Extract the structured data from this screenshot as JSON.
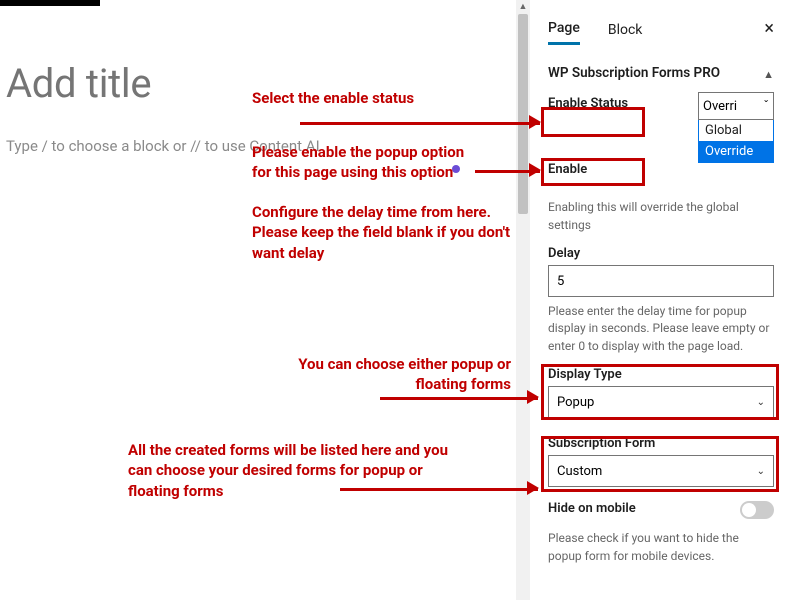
{
  "editor": {
    "title_placeholder": "Add title",
    "body_placeholder": "Type / to choose a block or // to use Content AI"
  },
  "sidebar": {
    "tabs": {
      "page": "Page",
      "block": "Block"
    },
    "panel_title": "WP Subscription Forms PRO",
    "enable_status": {
      "label": "Enable Status",
      "selected": "Overri",
      "options": {
        "global": "Global",
        "override": "Override"
      }
    },
    "enable": {
      "label": "Enable",
      "help": "Enabling this will override the global settings"
    },
    "delay": {
      "label": "Delay",
      "value": "5",
      "help": "Please enter the delay time for popup display in seconds. Please leave empty or enter 0 to display with the page load."
    },
    "display_type": {
      "label": "Display Type",
      "selected": "Popup"
    },
    "subscription_form": {
      "label": "Subscription Form",
      "selected": "Custom"
    },
    "hide_mobile": {
      "label": "Hide on mobile",
      "help": "Please check if you want to hide the popup form for mobile devices."
    }
  },
  "annotations": {
    "a1": "Select the enable status",
    "a2": "Please enable the popup option for this page using this option",
    "a3": "Configure the delay time from here. Please keep the field blank if you don't want delay",
    "a4": "You can choose either popup or floating forms",
    "a5": "All the created forms will be listed here and you can choose your desired forms for popup or floating forms"
  }
}
